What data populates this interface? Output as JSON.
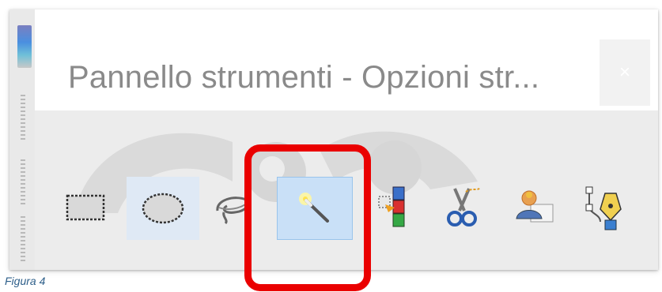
{
  "window": {
    "title": "Pannello strumenti - Opzioni str...",
    "close_label": "×"
  },
  "tools": [
    {
      "name": "rect-select",
      "state": "normal"
    },
    {
      "name": "ellipse-select",
      "state": "hover"
    },
    {
      "name": "free-select",
      "state": "normal"
    },
    {
      "name": "fuzzy-select",
      "state": "active"
    },
    {
      "name": "select-by-color",
      "state": "normal"
    },
    {
      "name": "scissors-select",
      "state": "normal"
    },
    {
      "name": "foreground-select",
      "state": "normal"
    },
    {
      "name": "paths",
      "state": "normal"
    }
  ],
  "annotation": {
    "highlight_color": "#ea0000",
    "highlighted_tool": "fuzzy-select"
  },
  "caption": "Figura 4"
}
